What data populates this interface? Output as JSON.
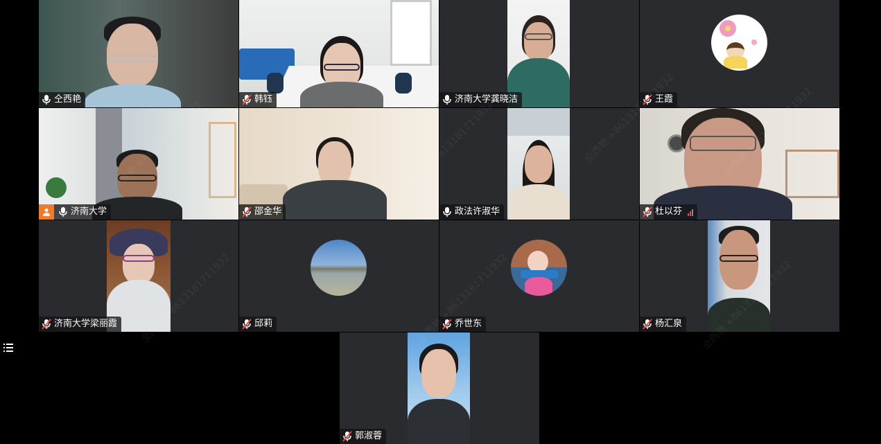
{
  "participants": [
    {
      "name": "仝西艳",
      "mic": "on",
      "speaking": true
    },
    {
      "name": "韩钰",
      "mic": "muted"
    },
    {
      "name": "济南大学龚晓洁",
      "mic": "on"
    },
    {
      "name": "王霞",
      "mic": "muted"
    },
    {
      "name": "济南大学",
      "mic": "on",
      "host": true
    },
    {
      "name": "邵金华",
      "mic": "muted"
    },
    {
      "name": "政法许淑华",
      "mic": "on"
    },
    {
      "name": "杜以芬",
      "mic": "muted",
      "signal": "weak"
    },
    {
      "name": "济南大学梁丽霞",
      "mic": "muted"
    },
    {
      "name": "邱莉",
      "mic": "muted"
    },
    {
      "name": "乔世东",
      "mic": "muted"
    },
    {
      "name": "杨汇泉",
      "mic": "muted"
    },
    {
      "name": "郭淑蓉",
      "mic": "muted"
    }
  ],
  "watermark": "仝西艳 +8613181711932",
  "colors": {
    "speaking_border": "#2fb36a",
    "host_badge": "#f07c2a",
    "muted_mic": "#e84848",
    "tile_bg": "#2a2b2e"
  },
  "icons": {
    "menu": "list-menu-icon",
    "mic_on": "microphone-icon",
    "mic_muted": "microphone-muted-icon",
    "host": "host-person-icon"
  }
}
